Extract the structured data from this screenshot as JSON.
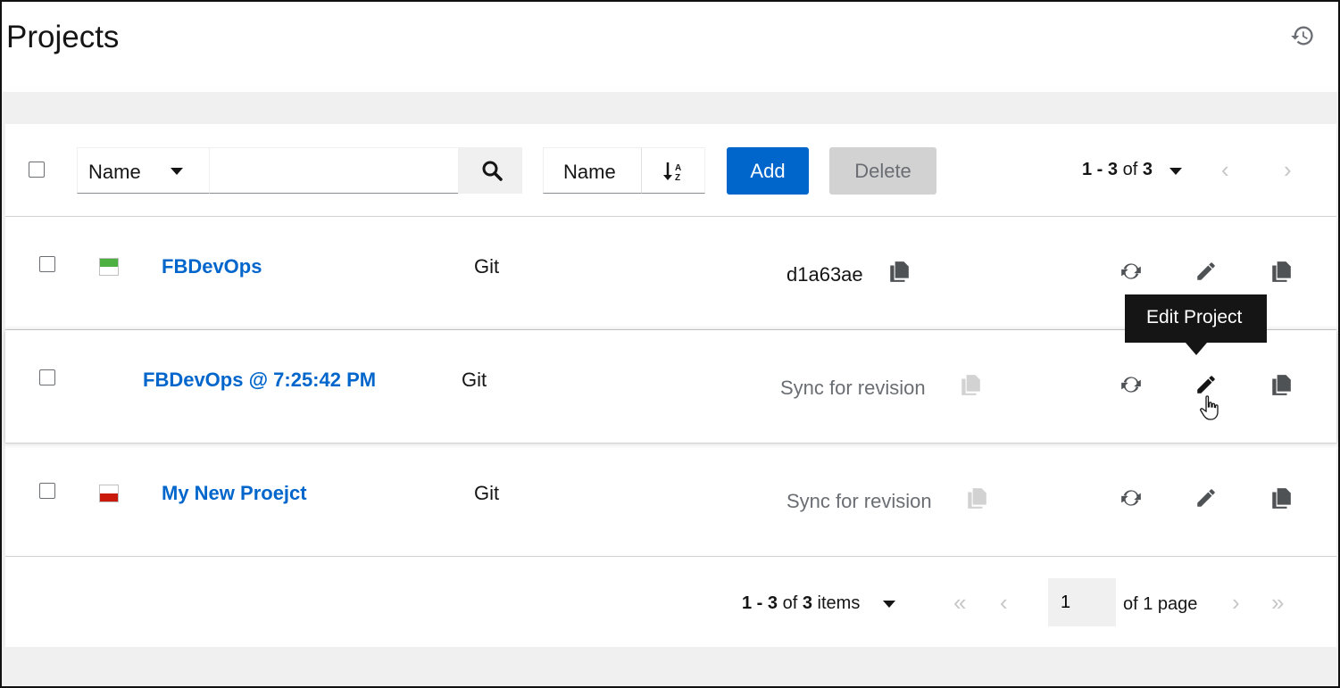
{
  "header": {
    "title": "Projects",
    "history_icon": "history-icon"
  },
  "toolbar": {
    "filter_attribute": "Name",
    "search_placeholder": "",
    "search_icon": "search-icon",
    "sort_attribute": "Name",
    "sort_icon": "sort-alpha-down-icon",
    "add_label": "Add",
    "delete_label": "Delete",
    "pagination": {
      "range": "1 - 3",
      "of": "of",
      "total": "3"
    }
  },
  "projects": [
    {
      "name": "FBDevOps",
      "type": "Git",
      "revision": "d1a63ae",
      "status": "successful",
      "status_color": "#4cb140"
    },
    {
      "name": "FBDevOps @ 7:25:42 PM",
      "type": "Git",
      "revision": "Sync for revision",
      "status": "none",
      "status_color": ""
    },
    {
      "name": "My New Proejct",
      "type": "Git",
      "revision": "Sync for revision",
      "status": "failed",
      "status_color": "#c9190b"
    }
  ],
  "row_actions": {
    "sync_icon": "sync-icon",
    "edit_icon": "pencil-icon",
    "copy_icon": "copy-icon"
  },
  "tooltip": {
    "text": "Edit Project"
  },
  "footer": {
    "range": "1 - 3",
    "of": "of",
    "total": "3",
    "items_label": "items",
    "page_value": "1",
    "of_pages": "of 1 page"
  },
  "colors": {
    "primary": "#0066cc",
    "link": "#0066cc",
    "success": "#4cb140",
    "danger": "#c9190b",
    "disabled": "#d2d2d2"
  }
}
